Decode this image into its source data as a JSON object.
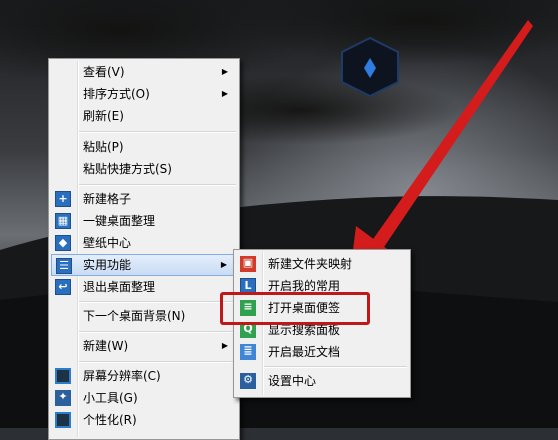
{
  "colors": {
    "highlight": "#c9dcf5",
    "callout": "#c01818",
    "arrow": "#d41c1c",
    "menu_bg": "#f0f0f0"
  },
  "context_menu": {
    "items": [
      {
        "label": "查看(V)",
        "has_submenu": true
      },
      {
        "label": "排序方式(O)",
        "has_submenu": true
      },
      {
        "label": "刷新(E)"
      },
      {
        "label": "粘贴(P)"
      },
      {
        "label": "粘贴快捷方式(S)"
      },
      {
        "label": "新建格子",
        "icon": "plus-icon"
      },
      {
        "label": "一键桌面整理",
        "icon": "grid-icon"
      },
      {
        "label": "壁纸中心",
        "icon": "cube-icon"
      },
      {
        "label": "实用功能",
        "icon": "list-icon",
        "has_submenu": true,
        "highlighted": true
      },
      {
        "label": "退出桌面整理",
        "icon": "exit-icon"
      },
      {
        "label": "下一个桌面背景(N)"
      },
      {
        "label": "新建(W)",
        "has_submenu": true
      },
      {
        "label": "屏幕分辨率(C)",
        "icon": "monitor-icon"
      },
      {
        "label": "小工具(G)",
        "icon": "gadget-icon"
      },
      {
        "label": "个性化(R)",
        "icon": "personalize-icon"
      }
    ]
  },
  "submenu": {
    "items": [
      {
        "label": "新建文件夹映射",
        "icon": "folder-map-icon"
      },
      {
        "label": "开启我的常用",
        "icon": "favorites-icon"
      },
      {
        "label": "打开桌面便签",
        "icon": "note-icon",
        "highlighted": true
      },
      {
        "label": "显示搜索面板",
        "icon": "search-icon"
      },
      {
        "label": "开启最近文档",
        "icon": "document-icon"
      },
      {
        "label": "设置中心",
        "icon": "gear-icon"
      }
    ]
  }
}
